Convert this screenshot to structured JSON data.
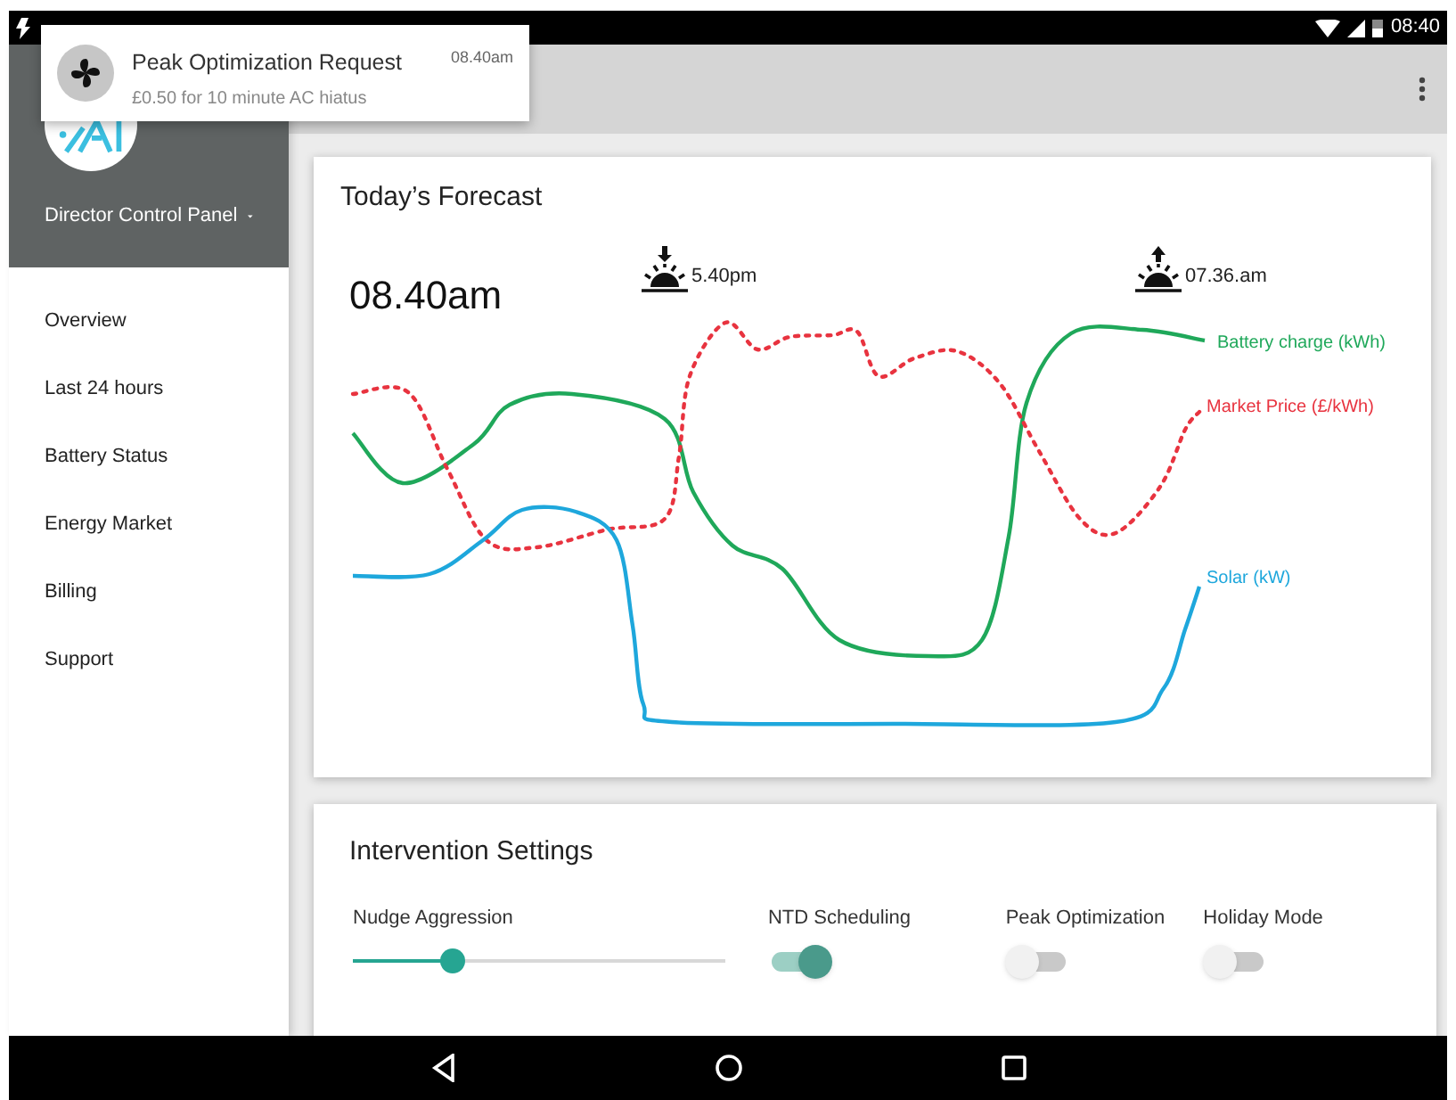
{
  "status_bar": {
    "time": "08:40"
  },
  "notification": {
    "title": "Peak Optimization Request",
    "time": "08.40am",
    "body": "£0.50 for 10 minute AC hiatus"
  },
  "sidebar": {
    "account": "Director Control Panel",
    "items": [
      {
        "label": "Overview"
      },
      {
        "label": "Last 24 hours"
      },
      {
        "label": "Battery Status"
      },
      {
        "label": "Energy Market"
      },
      {
        "label": "Billing"
      },
      {
        "label": "Support"
      }
    ]
  },
  "forecast": {
    "title": "Today’s Forecast",
    "current_time": "08.40am",
    "events": [
      {
        "kind": "sunset",
        "time": "5.40pm"
      },
      {
        "kind": "sunrise",
        "time": "07.36.am"
      }
    ],
    "series": [
      {
        "label": "Battery charge (kWh)",
        "color": "#1fa85a",
        "kind": "solid"
      },
      {
        "label": "Market Price (£/kWh)",
        "color": "#e8333f",
        "kind": "dotted"
      },
      {
        "label": "Solar (kW)",
        "color": "#1ea7dc",
        "kind": "solid"
      }
    ]
  },
  "settings": {
    "title": "Intervention Settings",
    "controls": [
      {
        "kind": "slider",
        "label": "Nudge Aggression",
        "level": 0.27
      },
      {
        "kind": "toggle",
        "label": "NTD Scheduling",
        "on": true
      },
      {
        "kind": "toggle",
        "label": "Peak Optimization",
        "on": false
      },
      {
        "kind": "toggle",
        "label": "Holiday Mode",
        "on": false
      }
    ]
  }
}
